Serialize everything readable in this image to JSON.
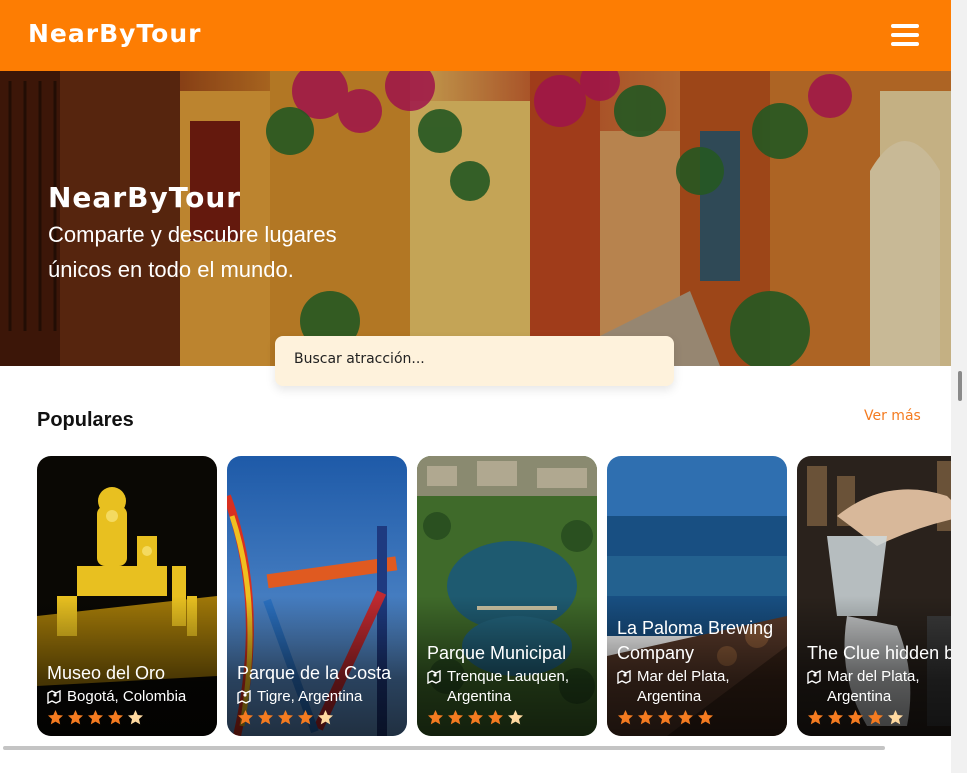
{
  "header": {
    "brand": "NearByTour",
    "menu_icon": "hamburger-menu-icon"
  },
  "hero": {
    "title": "NearByTour",
    "subtitle": "Comparte y descubre lugares únicos en todo el mundo."
  },
  "search": {
    "placeholder": "Buscar atracción..."
  },
  "popular": {
    "title": "Populares",
    "see_more": "Ver más",
    "cards": [
      {
        "name": "Museo del Oro",
        "location": "Bogotá, Colombia",
        "rating": 4
      },
      {
        "name": "Parque de la Costa",
        "location": "Tigre, Argentina",
        "rating": 4
      },
      {
        "name": "Parque Municipal",
        "location": "Trenque Lauquen, Argentina",
        "rating": 4
      },
      {
        "name": "La Paloma Brewing Company",
        "location": "Mar del Plata, Argentina",
        "rating": 5
      },
      {
        "name": "The Clue hidden bar",
        "location": "Mar del Plata, Argentina",
        "rating": 4.5
      }
    ]
  },
  "colors": {
    "accent": "#fd7d03",
    "search_bg": "#fef2dc",
    "star_full": "#f47b20",
    "star_empty": "#ffd9a0"
  }
}
